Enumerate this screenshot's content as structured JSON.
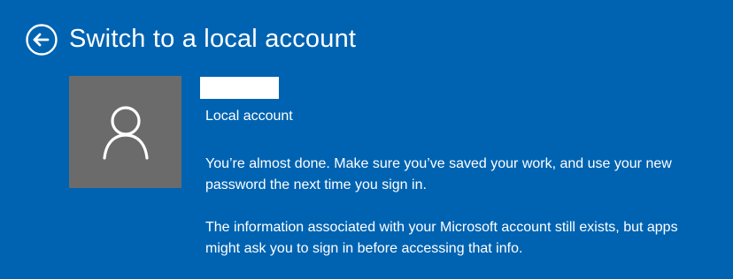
{
  "page": {
    "title": "Switch to a local account",
    "back_icon": "back-arrow-icon",
    "colors": {
      "background": "#0063b1",
      "text": "#ffffff",
      "avatar_background": "#6b6b6b",
      "name_box": "#ffffff"
    }
  },
  "account": {
    "avatar_icon": "user-icon",
    "type_label": "Local account"
  },
  "messages": {
    "almost_done": "You’re almost done. Make sure you’ve saved your work, and use your new password the next time you sign in.",
    "info_exists": "The information associated with your Microsoft account still exists, but apps might ask you to sign in before accessing that info."
  }
}
